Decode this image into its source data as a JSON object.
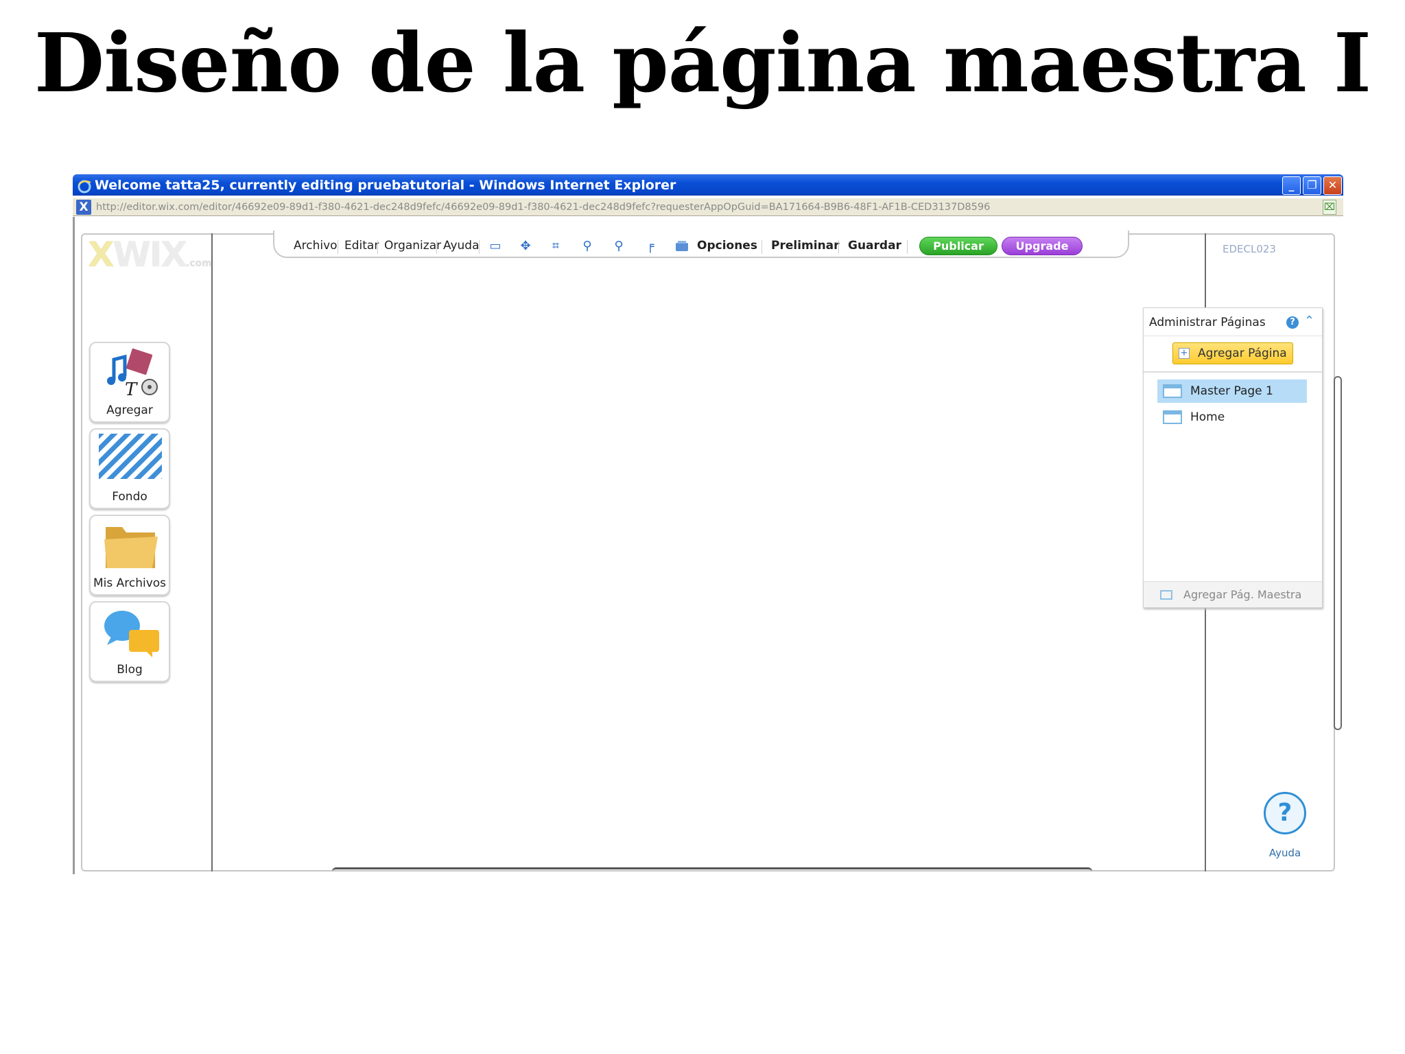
{
  "slide": {
    "title": "Diseño de la página maestra I"
  },
  "browser": {
    "title": "Welcome tatta25, currently editing pruebatutorial - Windows Internet Explorer",
    "url": "http://editor.wix.com/editor/46692e09-89d1-f380-4621-dec248d9fefc/46692e09-89d1-f380-4621-dec248d9fefc?requesterAppOpGuid=BA171664-B9B6-48F1-AF1B-CED3137D8596",
    "controls": {
      "minimize": "_",
      "restore": "❐",
      "close": "✕"
    }
  },
  "editor": {
    "logo": {
      "x": "X",
      "wix": "WIX",
      "suffix": ".com"
    },
    "menu": {
      "items": [
        "Archivo",
        "Editar",
        "Organizar",
        "Ayuda"
      ],
      "tools": [
        {
          "icon": "comment-icon",
          "glyph": "▭"
        },
        {
          "icon": "move-icon",
          "glyph": "✥"
        },
        {
          "icon": "crop-icon",
          "glyph": "⌗"
        },
        {
          "icon": "zoom-in-icon",
          "glyph": "⚲"
        },
        {
          "icon": "zoom-out-icon",
          "glyph": "⚲"
        },
        {
          "icon": "ruler-icon",
          "glyph": "╒"
        }
      ],
      "options": "Opciones",
      "preview": "Preliminar",
      "save": "Guardar",
      "publish": "Publicar",
      "upgrade": "Upgrade",
      "colors": {
        "publish": "#2aa326",
        "upgrade": "#9a3fd8"
      }
    },
    "account": "EDECL023",
    "left_tools": [
      "Agregar",
      "Fondo",
      "Mis Archivos",
      "Blog"
    ],
    "pages_panel": {
      "title": "Administrar Páginas",
      "add_page": "Agregar Página",
      "pages": [
        {
          "name": "Master Page 1",
          "selected": true
        },
        {
          "name": "Home",
          "selected": false
        }
      ],
      "add_master": "Agregar Pág. Maestra"
    },
    "help": {
      "label": "Ayuda",
      "glyph": "?"
    }
  }
}
